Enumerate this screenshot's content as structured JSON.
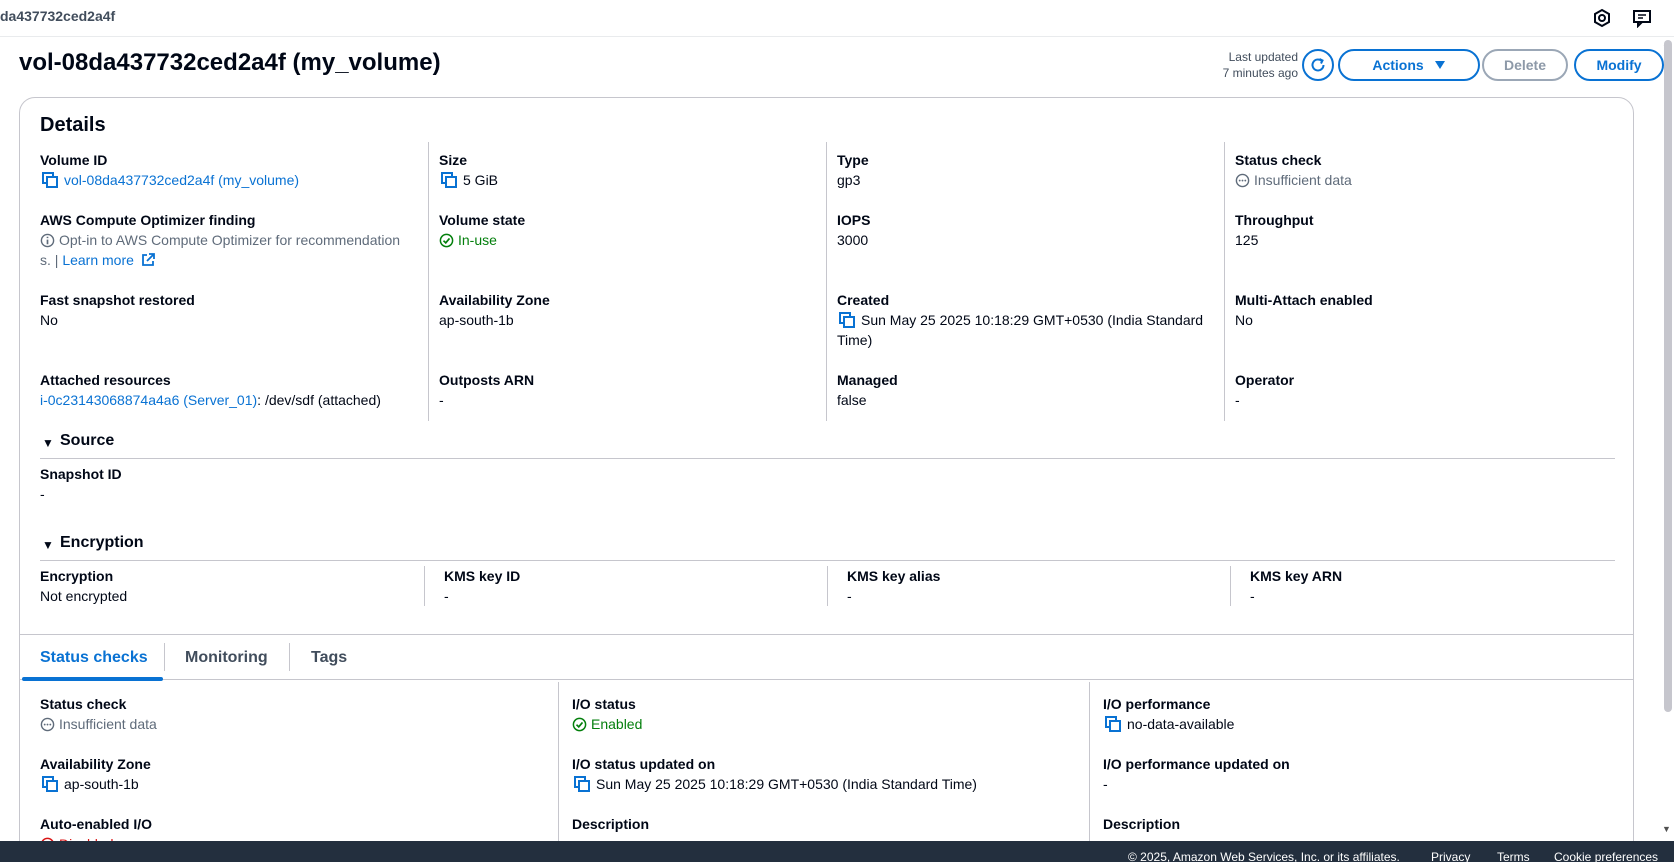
{
  "topbar": {
    "breadcrumb": "da437732ced2a4f",
    "icons": [
      "settings-hex-icon",
      "feedback-icon"
    ]
  },
  "header": {
    "title": "vol-08da437732ced2a4f (my_volume)",
    "last_updated_label": "Last updated",
    "last_updated_value": "7 minutes ago",
    "actions_label": "Actions",
    "delete_label": "Delete",
    "modify_label": "Modify"
  },
  "details": {
    "title": "Details",
    "volume_id": {
      "label": "Volume ID",
      "value": "vol-08da437732ced2a4f (my_volume)"
    },
    "size": {
      "label": "Size",
      "value": "5 GiB"
    },
    "type": {
      "label": "Type",
      "value": "gp3"
    },
    "status_check": {
      "label": "Status check",
      "value": "Insufficient data"
    },
    "optimizer": {
      "label": "AWS Compute Optimizer finding",
      "text_line1": "Opt-in to AWS Compute Optimizer for recommendation",
      "text_line2": "s. | ",
      "learn_more": "Learn more"
    },
    "volume_state": {
      "label": "Volume state",
      "value": "In-use"
    },
    "iops": {
      "label": "IOPS",
      "value": "3000"
    },
    "throughput": {
      "label": "Throughput",
      "value": "125"
    },
    "fast_snapshot": {
      "label": "Fast snapshot restored",
      "value": "No"
    },
    "az": {
      "label": "Availability Zone",
      "value": "ap-south-1b"
    },
    "created": {
      "label": "Created",
      "value_line1": "Sun May 25 2025 10:18:29 GMT+0530 (India Standard",
      "value_line2": "Time)"
    },
    "multi_attach": {
      "label": "Multi-Attach enabled",
      "value": "No"
    },
    "attached": {
      "label": "Attached resources",
      "instance": "i-0c23143068874a4a6 (Server_01)",
      "suffix": ": /dev/sdf (attached)"
    },
    "outposts": {
      "label": "Outposts ARN",
      "value": "-"
    },
    "managed": {
      "label": "Managed",
      "value": "false"
    },
    "operator": {
      "label": "Operator",
      "value": "-"
    }
  },
  "source": {
    "title": "Source",
    "snapshot_id": {
      "label": "Snapshot ID",
      "value": "-"
    }
  },
  "encryption": {
    "title": "Encryption",
    "encryption": {
      "label": "Encryption",
      "value": "Not encrypted"
    },
    "kms_key_id": {
      "label": "KMS key ID",
      "value": "-"
    },
    "kms_key_alias": {
      "label": "KMS key alias",
      "value": "-"
    },
    "kms_key_arn": {
      "label": "KMS key ARN",
      "value": "-"
    }
  },
  "tabs": [
    {
      "label": "Status checks",
      "active": true
    },
    {
      "label": "Monitoring",
      "active": false
    },
    {
      "label": "Tags",
      "active": false
    }
  ],
  "status_checks": {
    "status_check": {
      "label": "Status check",
      "value": "Insufficient data"
    },
    "io_status": {
      "label": "I/O status",
      "value": "Enabled"
    },
    "io_performance": {
      "label": "I/O performance",
      "value": "no-data-available"
    },
    "az": {
      "label": "Availability Zone",
      "value": "ap-south-1b"
    },
    "io_status_updated": {
      "label": "I/O status updated on",
      "value": "Sun May 25 2025 10:18:29 GMT+0530 (India Standard Time)"
    },
    "io_perf_updated": {
      "label": "I/O performance updated on",
      "value": "-"
    },
    "auto_enabled": {
      "label": "Auto-enabled I/O",
      "value": "Disabled"
    },
    "description_1": {
      "label": "Description"
    },
    "description_2": {
      "label": "Description"
    }
  },
  "footer": {
    "copyright": "© 2025, Amazon Web Services, Inc. or its affiliates.",
    "privacy": "Privacy",
    "terms": "Terms",
    "cookies": "Cookie preferences"
  },
  "colors": {
    "link": "#0972d3",
    "success": "#037f0c",
    "error": "#d91515",
    "footer_bg": "#232f3e"
  }
}
